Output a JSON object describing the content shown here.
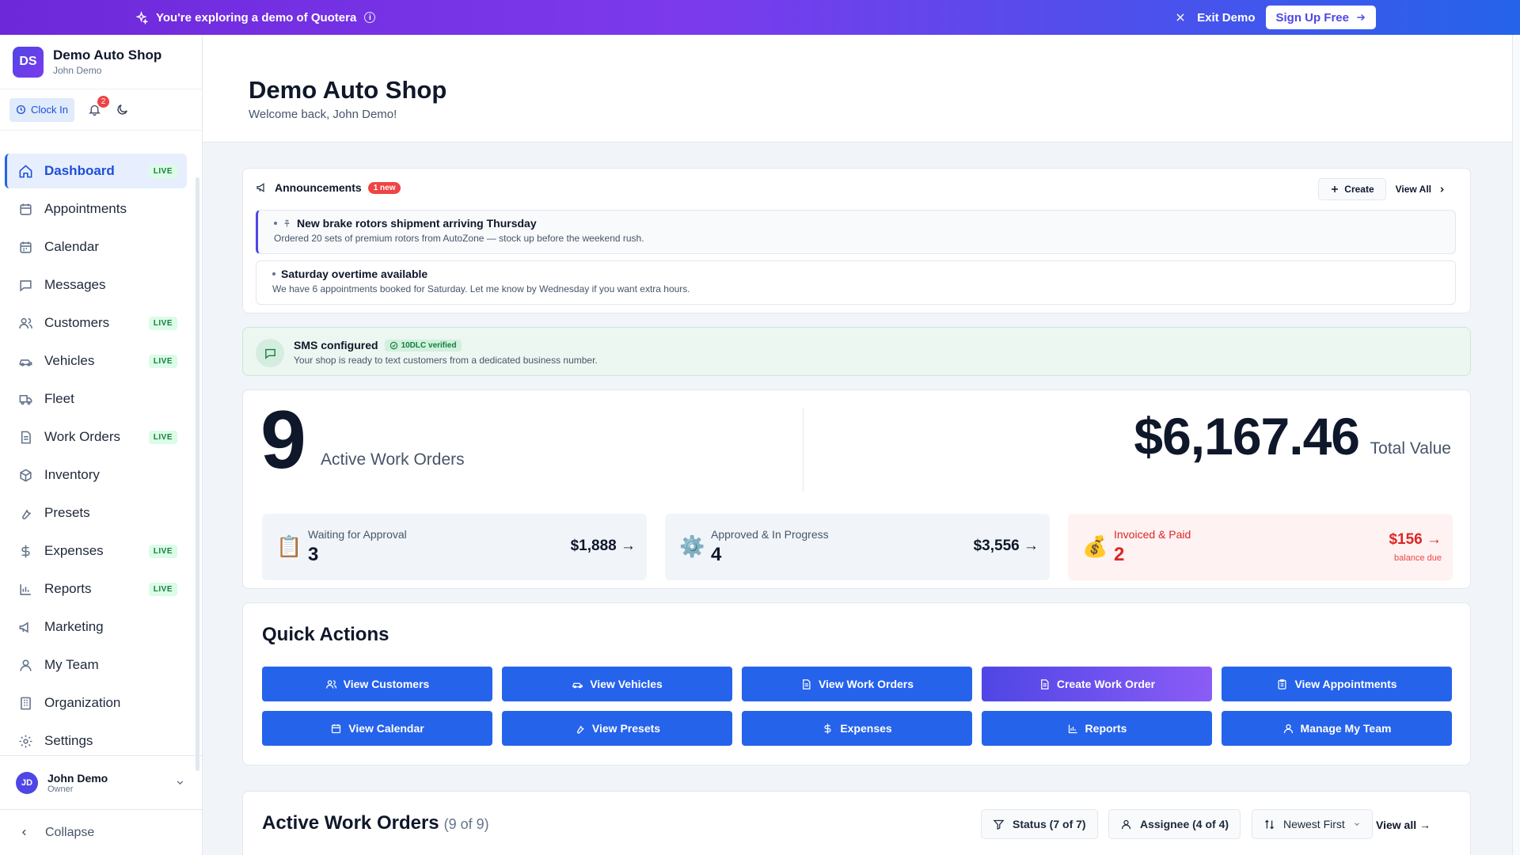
{
  "banner": {
    "message": "You're exploring a demo of Quotera",
    "exit_label": "Exit Demo",
    "signup_label": "Sign Up Free"
  },
  "sidebar": {
    "avatar_initials": "DS",
    "shop_name": "Demo Auto Shop",
    "user_name": "John Demo",
    "clock_in_label": "Clock In",
    "notification_count": "2",
    "items": [
      {
        "label": "Dashboard",
        "icon": "home-icon",
        "live": "LIVE"
      },
      {
        "label": "Appointments",
        "icon": "calendar-check-icon",
        "live": ""
      },
      {
        "label": "Calendar",
        "icon": "calendar-icon",
        "live": ""
      },
      {
        "label": "Messages",
        "icon": "message-icon",
        "live": ""
      },
      {
        "label": "Customers",
        "icon": "users-icon",
        "live": "LIVE"
      },
      {
        "label": "Vehicles",
        "icon": "car-icon",
        "live": "LIVE"
      },
      {
        "label": "Fleet",
        "icon": "truck-icon",
        "live": ""
      },
      {
        "label": "Work Orders",
        "icon": "document-icon",
        "live": "LIVE"
      },
      {
        "label": "Inventory",
        "icon": "box-icon",
        "live": ""
      },
      {
        "label": "Presets",
        "icon": "wrench-icon",
        "live": ""
      },
      {
        "label": "Expenses",
        "icon": "dollar-icon",
        "live": "LIVE"
      },
      {
        "label": "Reports",
        "icon": "bar-chart-icon",
        "live": "LIVE"
      },
      {
        "label": "Marketing",
        "icon": "megaphone-icon",
        "live": ""
      },
      {
        "label": "My Team",
        "icon": "user-icon",
        "live": ""
      },
      {
        "label": "Organization",
        "icon": "building-icon",
        "live": ""
      },
      {
        "label": "Settings",
        "icon": "gear-icon",
        "live": ""
      }
    ],
    "footer_avatar": "JD",
    "footer_name": "John Demo",
    "footer_role": "Owner",
    "collapse_label": "Collapse"
  },
  "header": {
    "title": "Demo Auto Shop",
    "subtitle": "Welcome back, John Demo!"
  },
  "announcements": {
    "title": "Announcements",
    "badge": "1 new",
    "create_label": "Create",
    "view_all_label": "View All",
    "items": [
      {
        "title": "New brake rotors shipment arriving Thursday",
        "body": "Ordered 20 sets of premium rotors from AutoZone — stock up before the weekend rush."
      },
      {
        "title": "Saturday overtime available",
        "body": "We have 6 appointments booked for Saturday. Let me know by Wednesday if you want extra hours."
      }
    ]
  },
  "sms": {
    "title": "SMS configured",
    "badge": "10DLC verified",
    "body": "Your shop is ready to text customers from a dedicated business number."
  },
  "stats": {
    "active_count": "9",
    "active_label": "Active Work Orders",
    "total_value": "$6,167.46",
    "total_label": "Total Value",
    "boxes": [
      {
        "emoji": "📋",
        "label": "Waiting for Approval",
        "count": "3",
        "value": "$1,888 →",
        "sub": ""
      },
      {
        "emoji": "⚙️",
        "label": "Approved & In Progress",
        "count": "4",
        "value": "$3,556 →",
        "sub": ""
      },
      {
        "emoji": "💰",
        "label": "Invoiced & Paid",
        "count": "2",
        "value": "$156 →",
        "sub": "balance due"
      }
    ]
  },
  "quick_actions": {
    "title": "Quick Actions",
    "buttons": [
      {
        "label": "View Customers",
        "icon": "users-icon"
      },
      {
        "label": "View Vehicles",
        "icon": "car-icon"
      },
      {
        "label": "View Work Orders",
        "icon": "document-icon"
      },
      {
        "label": "Create Work Order",
        "icon": "document-plus-icon"
      },
      {
        "label": "View Appointments",
        "icon": "clipboard-icon"
      },
      {
        "label": "View Calendar",
        "icon": "calendar-icon"
      },
      {
        "label": "View Presets",
        "icon": "wrench-icon"
      },
      {
        "label": "Expenses",
        "icon": "dollar-icon"
      },
      {
        "label": "Reports",
        "icon": "bar-chart-icon"
      },
      {
        "label": "Manage My Team",
        "icon": "user-icon"
      }
    ]
  },
  "active_work_orders": {
    "title": "Active Work Orders",
    "count": "(9 of 9)",
    "status_filter": "Status (7 of 7)",
    "assignee_filter": "Assignee (4 of 4)",
    "sort_label": "Newest First",
    "view_all_label": "View all →"
  },
  "colors": {
    "primary": "#2563eb",
    "banner_start": "#6d28d9",
    "banner_end": "#2563eb",
    "live_badge": "#15803d",
    "danger": "#dc2626"
  }
}
